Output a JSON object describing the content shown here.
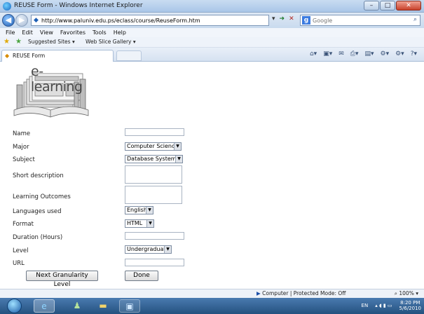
{
  "window": {
    "title": "REUSE Form - Windows Internet Explorer",
    "min_label": "–",
    "max_label": "□",
    "close_label": "✕"
  },
  "address": {
    "url": "http://www.paluniv.edu.ps/eclass/course/ReuseForm.htm",
    "search_placeholder": "Google"
  },
  "menu": [
    "File",
    "Edit",
    "View",
    "Favorites",
    "Tools",
    "Help"
  ],
  "favorites": {
    "items": [
      "Suggested Sites ▾",
      "Web Slice Gallery ▾"
    ]
  },
  "tabs": {
    "active_label": "REUSE Form"
  },
  "page": {
    "logo_text": "e-learning",
    "form": {
      "name_label": "Name",
      "major_label": "Major",
      "major_value": "Computer Science",
      "subject_label": "Subject",
      "subject_value": "Database Systems",
      "short_desc_label": "Short description",
      "outcomes_label": "Learning Outcomes",
      "languages_label": "Languages used",
      "languages_value": "English",
      "format_label": "Format",
      "format_value": "HTML",
      "duration_label": "Duration (Hours)",
      "level_label": "Level",
      "level_value": "Undergraduate",
      "url_label": "URL",
      "next_button": "Next Granularity Level",
      "done_button": "Done"
    }
  },
  "status": {
    "zone": "Computer | Protected Mode: Off",
    "zoom": "100%"
  },
  "taskbar": {
    "lang": "EN",
    "time": "8:20 PM",
    "date": "5/6/2010"
  }
}
